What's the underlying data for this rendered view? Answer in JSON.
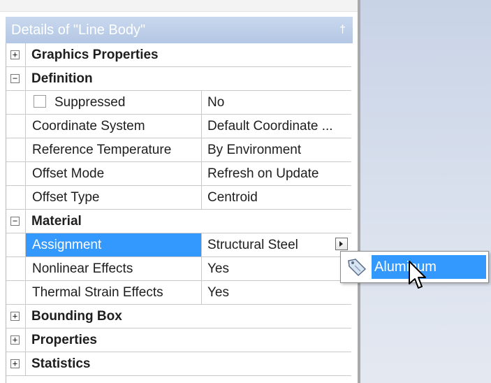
{
  "panel": {
    "title": "Details of \"Line Body\"",
    "pin_glyph": "†"
  },
  "groups": {
    "graphics": {
      "label": "Graphics Properties",
      "toggle": "+"
    },
    "definition": {
      "label": "Definition",
      "toggle": "−"
    },
    "material": {
      "label": "Material",
      "toggle": "−"
    },
    "bounding": {
      "label": "Bounding Box",
      "toggle": "+"
    },
    "properties": {
      "label": "Properties",
      "toggle": "+"
    },
    "statistics": {
      "label": "Statistics",
      "toggle": "+"
    }
  },
  "definition": {
    "suppressed": {
      "key": "Suppressed",
      "value": "No"
    },
    "coordinate_system": {
      "key": "Coordinate System",
      "value": "Default Coordinate ..."
    },
    "reference_temperature": {
      "key": "Reference Temperature",
      "value": "By Environment"
    },
    "offset_mode": {
      "key": "Offset Mode",
      "value": "Refresh on Update"
    },
    "offset_type": {
      "key": "Offset Type",
      "value": "Centroid"
    }
  },
  "material": {
    "assignment": {
      "key": "Assignment",
      "value": "Structural Steel"
    },
    "nonlinear": {
      "key": "Nonlinear Effects",
      "value": "Yes"
    },
    "thermal": {
      "key": "Thermal Strain Effects",
      "value": "Yes"
    }
  },
  "dropdown": {
    "option": "Aluminum",
    "icon": "material-tag-icon"
  },
  "colors": {
    "selection": "#3399ff",
    "titlebar": "#b3c6e3"
  }
}
